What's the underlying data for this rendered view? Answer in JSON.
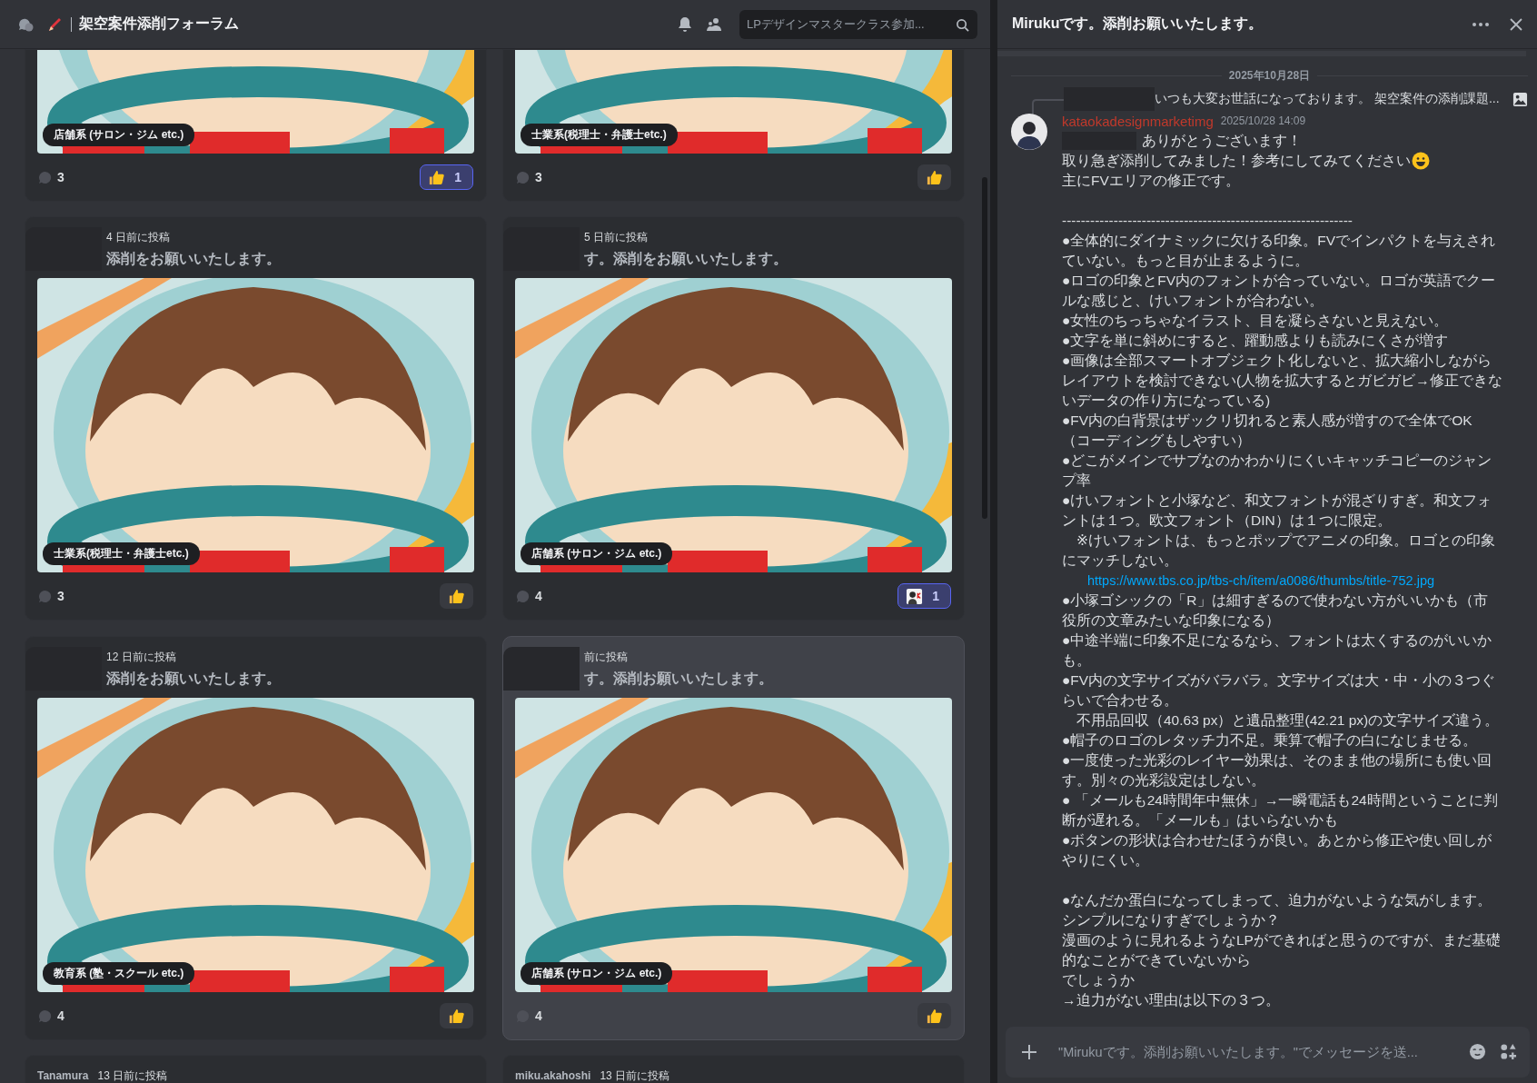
{
  "header": {
    "channel_title": "架空案件添削フォーラム",
    "search": {
      "placeholder": "LPデザインマスタークラス参加..."
    }
  },
  "posts": [
    {
      "kind": "cut",
      "tag": "店舗系 (サロン・ジム etc.)",
      "comments": "3",
      "reaction": {
        "kind": "thumbs",
        "count": "1",
        "selected": true
      },
      "hovered": false
    },
    {
      "kind": "cut",
      "tag": "士業系(税理士・弁護士etc.)",
      "comments": "3",
      "reaction": {
        "kind": "thumbs",
        "selected": false
      },
      "hovered": false
    },
    {
      "kind": "full",
      "redacted": true,
      "time": "4 日前に投稿",
      "title": "添削をお願いいたします。",
      "tag": "士業系(税理士・弁護士etc.)",
      "comments": "3",
      "reaction": {
        "kind": "thumbs",
        "selected": false
      },
      "hovered": false
    },
    {
      "kind": "full",
      "redacted": true,
      "time": "5 日前に投稿",
      "title": "す。添削をお願いいたします。",
      "tag": "店舗系 (サロン・ジム etc.)",
      "comments": "4",
      "reaction": {
        "kind": "sticker",
        "count": "1",
        "selected": true
      },
      "hovered": false
    },
    {
      "kind": "full",
      "redacted": true,
      "time": "12 日前に投稿",
      "title": "添削をお願いいたします。",
      "tag": "教育系 (塾・スクール etc.)",
      "comments": "4",
      "reaction": {
        "kind": "thumbs",
        "selected": false
      },
      "hovered": false
    },
    {
      "kind": "full",
      "redacted": true,
      "time": "前に投稿",
      "title": "す。添削お願いいたします。",
      "tag": "店舗系 (サロン・ジム etc.)",
      "comments": "4",
      "reaction": {
        "kind": "thumbs",
        "selected": false
      },
      "hovered": true
    },
    {
      "kind": "stub",
      "author": "Tanamura",
      "time": "13 日前に投稿",
      "hovered": false
    },
    {
      "kind": "stub",
      "author": "miku.akahoshi",
      "time": "13 日前に投稿",
      "hovered": false
    }
  ],
  "thread": {
    "title": "Mirukuです。添削お願いいたします。",
    "date": "2025年10月28日",
    "reply_quote": "いつも大変お世話になっております。 架空案件の添削課題...",
    "author": "kataokadesignmarketimg",
    "timestamp": "2025/10/28 14:09",
    "first_line": "ありがとうございます！",
    "lines": [
      {
        "kind": "emoji",
        "text": "取り急ぎ添削してみました！参考にしてみてください"
      },
      {
        "kind": "text",
        "text": "主にFVエリアの修正です。"
      },
      {
        "kind": "gap"
      },
      {
        "kind": "text",
        "text": "--------------------------------------------------------------"
      },
      {
        "kind": "text",
        "text": "●全体的にダイナミックに欠ける印象。FVでインパクトを与えされ"
      },
      {
        "kind": "text",
        "text": "ていない。もっと目が止まるように。"
      },
      {
        "kind": "text",
        "text": "●ロゴの印象とFV内のフォントが合っていない。ロゴが英語でクー"
      },
      {
        "kind": "text",
        "text": "ルな感じと、けいフォントが合わない。"
      },
      {
        "kind": "text",
        "text": "●女性のちっちゃなイラスト、目を凝らさないと見えない。"
      },
      {
        "kind": "text",
        "text": "●文字を単に斜めにすると、躍動感よりも読みにくさが増す"
      },
      {
        "kind": "text",
        "text": "●画像は全部スマートオブジェクト化しないと、拡大縮小しながら"
      },
      {
        "kind": "text",
        "text": "レイアウトを検討できない(人物を拡大するとガビガビ→修正できな"
      },
      {
        "kind": "text",
        "text": "いデータの作り方になっている)"
      },
      {
        "kind": "text",
        "text": "●FV内の白背景はザックリ切れると素人感が増すので全体でOK"
      },
      {
        "kind": "text",
        "text": "（コーディングもしやすい）"
      },
      {
        "kind": "text",
        "text": "●どこがメインでサブなのかわかりにくいキャッチコピーのジャン"
      },
      {
        "kind": "text",
        "text": "プ率"
      },
      {
        "kind": "text",
        "text": "●けいフォントと小塚など、和文フォントが混ざりすぎ。和文フォ"
      },
      {
        "kind": "text",
        "text": "ントは１つ。欧文フォント（DIN）は１つに限定。"
      },
      {
        "kind": "text",
        "text": "　※けいフォントは、もっとポップでアニメの印象。ロゴとの印象"
      },
      {
        "kind": "text",
        "text": "にマッチしない。"
      },
      {
        "kind": "link",
        "text": "https://www.tbs.co.jp/tbs-ch/item/a0086/thumbs/title-752.jpg"
      },
      {
        "kind": "text",
        "text": "●小塚ゴシックの「R」は細すぎるので使わない方がいいかも（市"
      },
      {
        "kind": "text",
        "text": "役所の文章みたいな印象になる）"
      },
      {
        "kind": "text",
        "text": "●中途半端に印象不足になるなら、フォントは太くするのがいいか"
      },
      {
        "kind": "text",
        "text": "も。"
      },
      {
        "kind": "text",
        "text": "●FV内の文字サイズがバラバラ。文字サイズは大・中・小の３つぐ"
      },
      {
        "kind": "text",
        "text": "らいで合わせる。"
      },
      {
        "kind": "text",
        "text": "　不用品回収（40.63 px）と遺品整理(42.21 px)の文字サイズ違う。"
      },
      {
        "kind": "text",
        "text": "●帽子のロゴのレタッチ力不足。乗算で帽子の白になじませる。"
      },
      {
        "kind": "text",
        "text": "●一度使った光彩のレイヤー効果は、そのまま他の場所にも使い回"
      },
      {
        "kind": "text",
        "text": "す。別々の光彩設定はしない。"
      },
      {
        "kind": "text",
        "text": "● 「メールも24時間年中無休」→一瞬電話も24時間ということに判"
      },
      {
        "kind": "text",
        "text": "断が遅れる。「メールも」はいらないかも"
      },
      {
        "kind": "text",
        "text": "●ボタンの形状は合わせたほうが良い。あとから修正や使い回しが"
      },
      {
        "kind": "text",
        "text": "やりにくい。"
      },
      {
        "kind": "gap"
      },
      {
        "kind": "text",
        "text": "●なんだか蛋白になってしまって、迫力がないような気がします。"
      },
      {
        "kind": "text",
        "text": "シンプルになりすぎでしょうか？"
      },
      {
        "kind": "text",
        "text": "漫画のように見れるようなLPができればと思うのですが、まだ基礎"
      },
      {
        "kind": "text",
        "text": "的なことができていないから"
      },
      {
        "kind": "text",
        "text": "でしょうか"
      },
      {
        "kind": "text",
        "text": "→迫力がない理由は以下の３つ。"
      }
    ]
  },
  "composer": {
    "placeholder": "\"Mirukuです。添削お願いいたします。\"でメッセージを送..."
  }
}
